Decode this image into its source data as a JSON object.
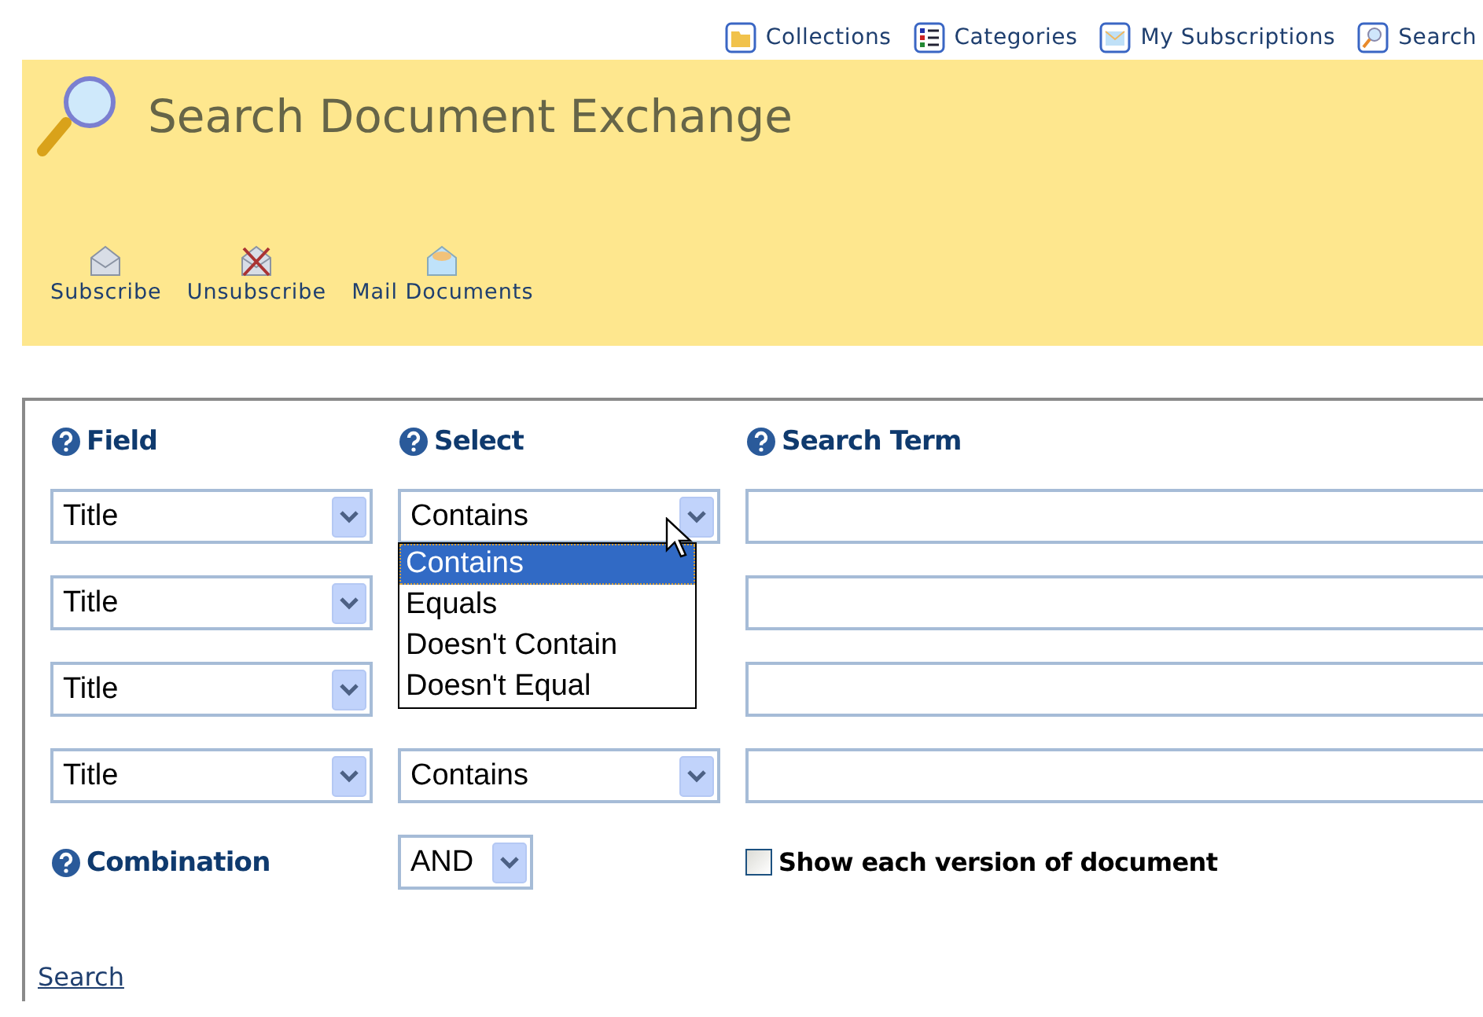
{
  "top_nav": [
    {
      "label": "Collections"
    },
    {
      "label": "Categories"
    },
    {
      "label": "My Subscriptions"
    },
    {
      "label": "Search"
    }
  ],
  "banner": {
    "title": "Search Document Exchange",
    "actions": [
      {
        "label": "Subscribe"
      },
      {
        "label": "Unsubscribe"
      },
      {
        "label": "Mail Documents"
      }
    ]
  },
  "form": {
    "headers": [
      "Field",
      "Select",
      "Search Term"
    ],
    "rows": [
      {
        "field": "Title",
        "select": "Contains",
        "term": "",
        "open_options": [
          {
            "label": "Contains",
            "selected": true
          },
          {
            "label": "Equals",
            "selected": false
          },
          {
            "label": "Doesn't Contain",
            "selected": false
          },
          {
            "label": "Doesn't Equal",
            "selected": false
          }
        ]
      },
      {
        "field": "Title",
        "term": ""
      },
      {
        "field": "Title",
        "term": ""
      },
      {
        "field": "Title",
        "select": "Contains",
        "term": ""
      }
    ],
    "combination": {
      "label": "Combination",
      "value": "AND"
    },
    "show_versions": {
      "label": "Show each version of document",
      "checked": false
    },
    "search_link": "Search"
  }
}
